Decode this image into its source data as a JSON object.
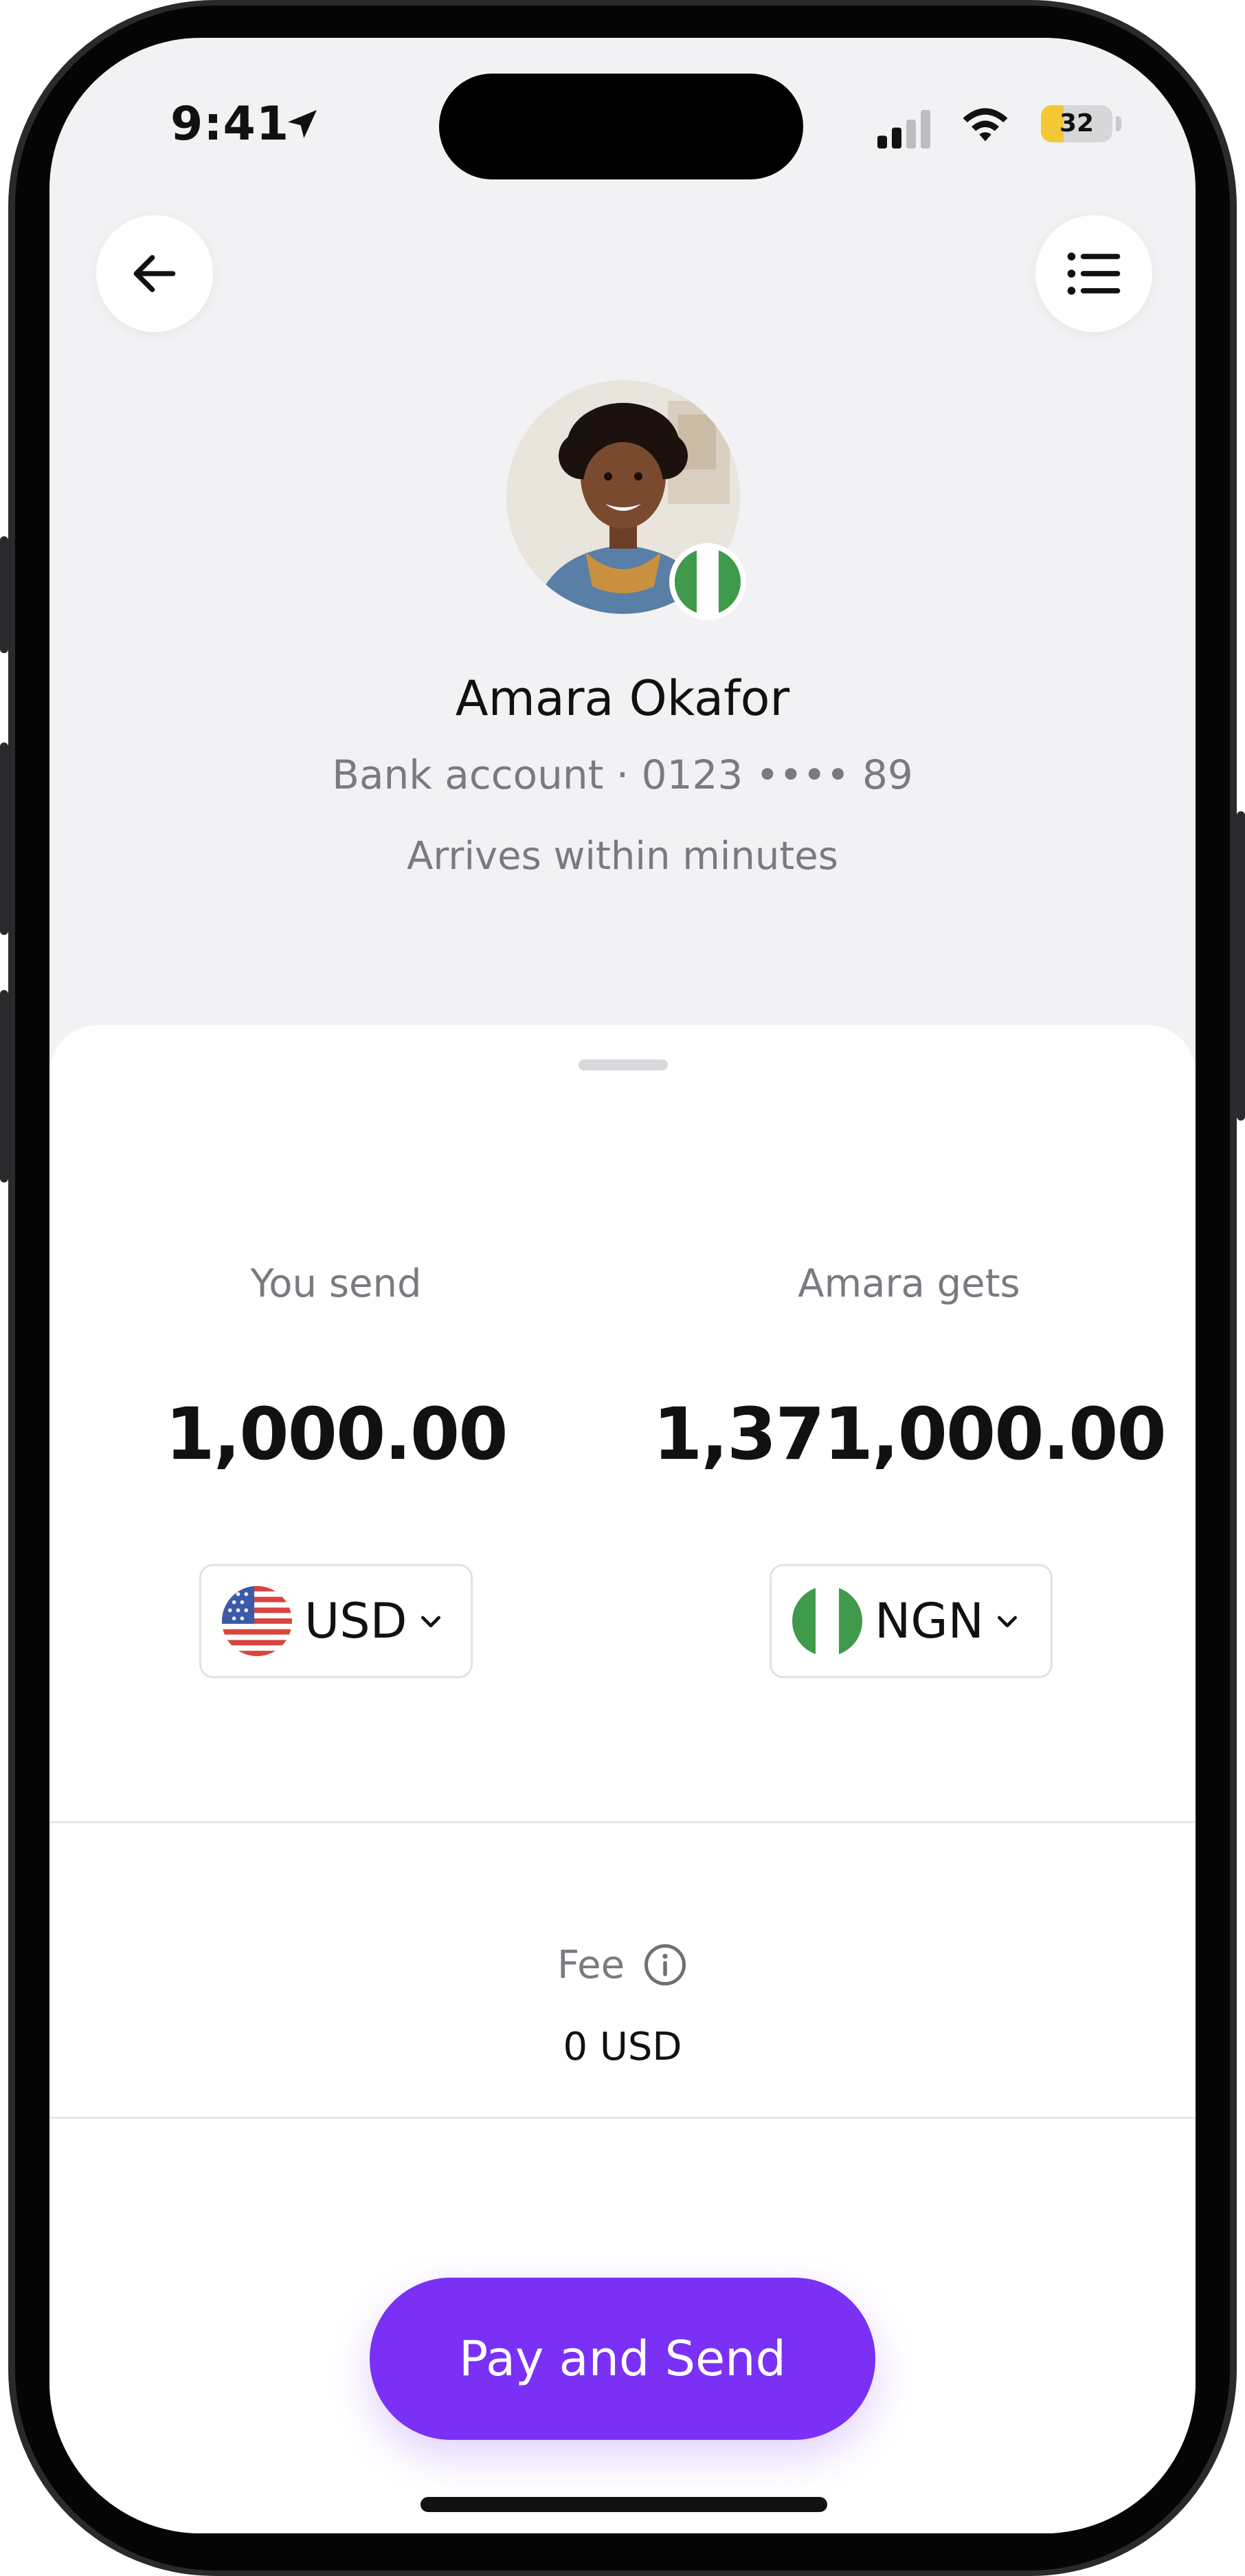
{
  "status_bar": {
    "time": "9:41",
    "battery_level": "32",
    "icons": [
      "location-arrow-icon",
      "cellular-signal-icon",
      "wifi-icon",
      "battery-icon"
    ]
  },
  "header": {
    "back_icon": "arrow-left-icon",
    "menu_icon": "list-icon"
  },
  "recipient": {
    "name": "Amara Okafor",
    "account": "Bank account · 0123 •••• 89",
    "arrival": "Arrives within minutes",
    "country_flag": "nigeria-flag-icon"
  },
  "send": {
    "label": "You send",
    "amount": "1,000.00",
    "currency": "USD",
    "flag": "us-flag-icon"
  },
  "receive": {
    "label": "Amara gets",
    "amount": "1,371,000.00",
    "currency": "NGN",
    "flag": "nigeria-flag-icon"
  },
  "fee": {
    "label": "Fee",
    "value": "0 USD"
  },
  "action": {
    "pay_label": "Pay and Send"
  },
  "colors": {
    "accent": "#7a30f5",
    "nigeria_green": "#3f9a4b",
    "battery_yellow": "#f4c734",
    "background": "#f2f2f4"
  }
}
